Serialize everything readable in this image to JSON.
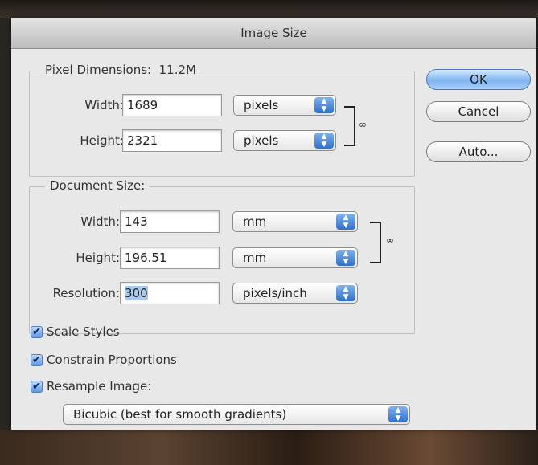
{
  "window": {
    "title": "Image Size"
  },
  "pixel_dimensions": {
    "title": "Pixel Dimensions:",
    "size": "11.2M",
    "width": {
      "label": "Width:",
      "value": "1689",
      "unit": "pixels"
    },
    "height": {
      "label": "Height:",
      "value": "2321",
      "unit": "pixels"
    }
  },
  "document_size": {
    "title": "Document Size:",
    "width": {
      "label": "Width:",
      "value": "143",
      "unit": "mm"
    },
    "height": {
      "label": "Height:",
      "value": "196.51",
      "unit": "mm"
    },
    "resolution": {
      "label": "Resolution:",
      "value": "300",
      "unit": "pixels/inch"
    }
  },
  "buttons": {
    "ok": "OK",
    "cancel": "Cancel",
    "auto": "Auto..."
  },
  "options": {
    "scale_styles": {
      "label": "Scale Styles",
      "checked": true
    },
    "constrain_proportions": {
      "label": "Constrain Proportions",
      "checked": true
    },
    "resample_image": {
      "label": "Resample Image:",
      "checked": true
    }
  },
  "resample_method": "Bicubic (best for smooth gradients)",
  "icons": {
    "checkmark": "✔",
    "popup_arrows": "▲▼",
    "link": "chain-link-icon"
  },
  "colors": {
    "accent": "#5d98e4",
    "selection": "#a9c9ee"
  }
}
